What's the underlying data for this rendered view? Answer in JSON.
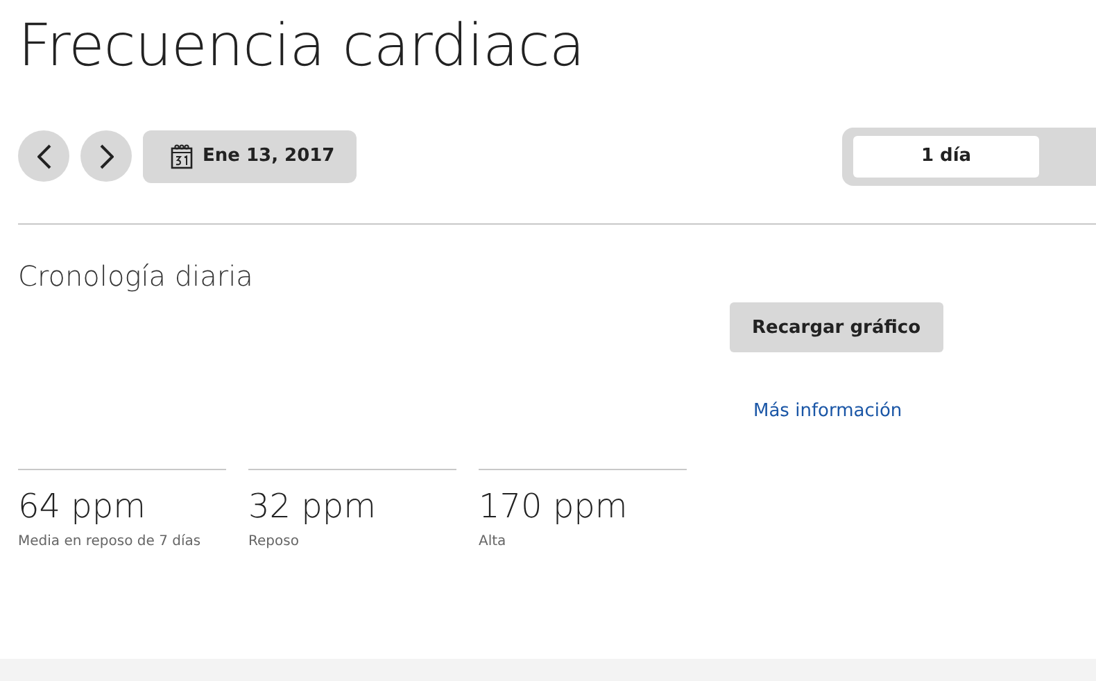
{
  "title": "Frecuencia cardiaca",
  "date_button": {
    "label": "Ene 13, 2017"
  },
  "range_tabs": [
    {
      "label": "1 día",
      "selected": true
    }
  ],
  "section": {
    "heading": "Cronología diaria",
    "reload_button": "Recargar gráfico",
    "more_link": "Más información"
  },
  "stats": [
    {
      "value": "64 ppm",
      "label": "Media en reposo de 7 días"
    },
    {
      "value": "32 ppm",
      "label": "Reposo"
    },
    {
      "value": "170 ppm",
      "label": "Alta"
    }
  ]
}
